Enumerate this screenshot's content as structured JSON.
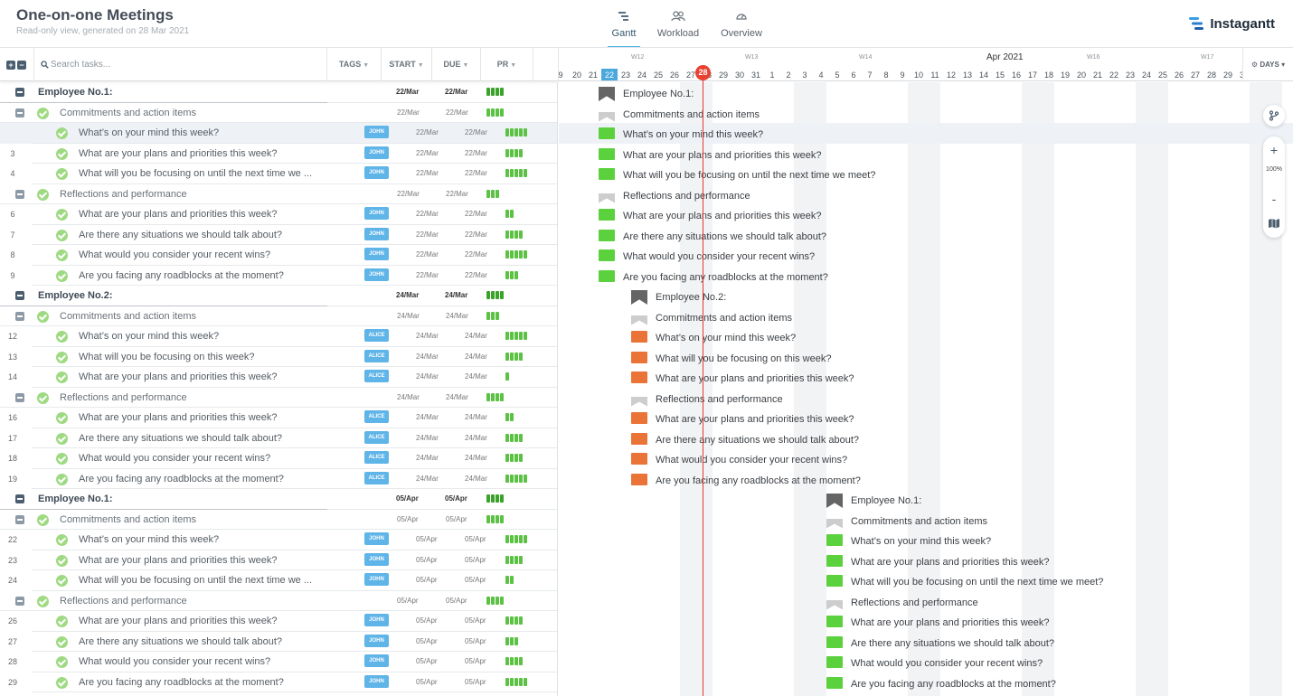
{
  "project": {
    "title": "One-on-one Meetings",
    "subtitle": "Read-only view, generated on 28 Mar 2021"
  },
  "tabs": [
    {
      "label": "Gantt",
      "icon": "gantt-icon",
      "active": true
    },
    {
      "label": "Workload",
      "icon": "users-icon",
      "active": false
    },
    {
      "label": "Overview",
      "icon": "dashboard-icon",
      "active": false
    }
  ],
  "brand": {
    "name": "Instagantt",
    "color": "#3b9ee8"
  },
  "search": {
    "placeholder": "Search tasks..."
  },
  "columns": {
    "tags": "TAGS",
    "start": "START",
    "due": "DUE",
    "pr": "PR"
  },
  "timeline": {
    "month": "Apr 2021",
    "weeks": [
      "W12",
      "W13",
      "W14",
      "W16",
      "W17"
    ],
    "days": [
      "9",
      "20",
      "21",
      "22",
      "23",
      "24",
      "25",
      "26",
      "27",
      "28",
      "29",
      "30",
      "31",
      "1",
      "2",
      "3",
      "4",
      "5",
      "6",
      "7",
      "8",
      "9",
      "10",
      "11",
      "12",
      "13",
      "14",
      "15",
      "16",
      "17",
      "18",
      "19",
      "20",
      "21",
      "22",
      "23",
      "24",
      "25",
      "26",
      "27",
      "28",
      "29",
      "30"
    ],
    "selected_day": "22",
    "today": "28",
    "scale_label": "DAYS"
  },
  "zoom": {
    "level": "100%",
    "plus": "+",
    "minus": "-"
  },
  "rows": [
    {
      "num": "",
      "type": "employee",
      "name": "Employee No.1:",
      "start": "22/Mar",
      "due": "22/Mar",
      "pr": 4
    },
    {
      "num": "",
      "type": "group",
      "name": "Commitments and action items",
      "start": "22/Mar",
      "due": "22/Mar",
      "pr": 4
    },
    {
      "num": "",
      "type": "task",
      "name": "What’s on your mind this week?",
      "tag": "JOHN",
      "start": "22/Mar",
      "due": "22/Mar",
      "pr": 5,
      "highlight": true
    },
    {
      "num": "3",
      "type": "task",
      "name": "What are your plans and priorities this week?",
      "tag": "JOHN",
      "start": "22/Mar",
      "due": "22/Mar",
      "pr": 4
    },
    {
      "num": "4",
      "type": "task",
      "name": "What will you be focusing on until the next time we ...",
      "tag": "JOHN",
      "start": "22/Mar",
      "due": "22/Mar",
      "pr": 5
    },
    {
      "num": "",
      "type": "group",
      "name": "Reflections and performance",
      "start": "22/Mar",
      "due": "22/Mar",
      "pr": 3
    },
    {
      "num": "6",
      "type": "task",
      "name": "What are your plans and priorities this week?",
      "tag": "JOHN",
      "start": "22/Mar",
      "due": "22/Mar",
      "pr": 2
    },
    {
      "num": "7",
      "type": "task",
      "name": "Are there any situations we should talk about?",
      "tag": "JOHN",
      "start": "22/Mar",
      "due": "22/Mar",
      "pr": 4
    },
    {
      "num": "8",
      "type": "task",
      "name": "What would you consider your recent wins?",
      "tag": "JOHN",
      "start": "22/Mar",
      "due": "22/Mar",
      "pr": 5
    },
    {
      "num": "9",
      "type": "task",
      "name": "Are you facing any roadblocks at the moment?",
      "tag": "JOHN",
      "start": "22/Mar",
      "due": "22/Mar",
      "pr": 3
    },
    {
      "num": "",
      "type": "employee",
      "name": "Employee No.2:",
      "start": "24/Mar",
      "due": "24/Mar",
      "pr": 4
    },
    {
      "num": "",
      "type": "group",
      "name": "Commitments and action items",
      "start": "24/Mar",
      "due": "24/Mar",
      "pr": 3
    },
    {
      "num": "12",
      "type": "task",
      "name": "What’s on your mind this week?",
      "tag": "ALICE",
      "start": "24/Mar",
      "due": "24/Mar",
      "pr": 5
    },
    {
      "num": "13",
      "type": "task",
      "name": "What will you be focusing on this week?",
      "tag": "ALICE",
      "start": "24/Mar",
      "due": "24/Mar",
      "pr": 4
    },
    {
      "num": "14",
      "type": "task",
      "name": "What are your plans and priorities this week?",
      "tag": "ALICE",
      "start": "24/Mar",
      "due": "24/Mar",
      "pr": 1
    },
    {
      "num": "",
      "type": "group",
      "name": "Reflections and performance",
      "start": "24/Mar",
      "due": "24/Mar",
      "pr": 4
    },
    {
      "num": "16",
      "type": "task",
      "name": "What are your plans and priorities this week?",
      "tag": "ALICE",
      "start": "24/Mar",
      "due": "24/Mar",
      "pr": 2
    },
    {
      "num": "17",
      "type": "task",
      "name": "Are there any situations we should talk about?",
      "tag": "ALICE",
      "start": "24/Mar",
      "due": "24/Mar",
      "pr": 4
    },
    {
      "num": "18",
      "type": "task",
      "name": "What would you consider your recent wins?",
      "tag": "ALICE",
      "start": "24/Mar",
      "due": "24/Mar",
      "pr": 4
    },
    {
      "num": "19",
      "type": "task",
      "name": "Are you facing any roadblocks at the moment?",
      "tag": "ALICE",
      "start": "24/Mar",
      "due": "24/Mar",
      "pr": 5
    },
    {
      "num": "",
      "type": "employee",
      "name": "Employee No.1:",
      "start": "05/Apr",
      "due": "05/Apr",
      "pr": 4
    },
    {
      "num": "",
      "type": "group",
      "name": "Commitments and action items",
      "start": "05/Apr",
      "due": "05/Apr",
      "pr": 4
    },
    {
      "num": "22",
      "type": "task",
      "name": "What’s on your mind this week?",
      "tag": "JOHN",
      "start": "05/Apr",
      "due": "05/Apr",
      "pr": 5
    },
    {
      "num": "23",
      "type": "task",
      "name": "What are your plans and priorities this week?",
      "tag": "JOHN",
      "start": "05/Apr",
      "due": "05/Apr",
      "pr": 4
    },
    {
      "num": "24",
      "type": "task",
      "name": "What will you be focusing on until the next time we ...",
      "tag": "JOHN",
      "start": "05/Apr",
      "due": "05/Apr",
      "pr": 2
    },
    {
      "num": "",
      "type": "group",
      "name": "Reflections and performance",
      "start": "05/Apr",
      "due": "05/Apr",
      "pr": 4
    },
    {
      "num": "26",
      "type": "task",
      "name": "What are your plans and priorities this week?",
      "tag": "JOHN",
      "start": "05/Apr",
      "due": "05/Apr",
      "pr": 4
    },
    {
      "num": "27",
      "type": "task",
      "name": "Are there any situations we should talk about?",
      "tag": "JOHN",
      "start": "05/Apr",
      "due": "05/Apr",
      "pr": 3
    },
    {
      "num": "28",
      "type": "task",
      "name": "What would you consider your recent wins?",
      "tag": "JOHN",
      "start": "05/Apr",
      "due": "05/Apr",
      "pr": 4
    },
    {
      "num": "29",
      "type": "task",
      "name": "Are you facing any roadblocks at the moment?",
      "tag": "JOHN",
      "start": "05/Apr",
      "due": "05/Apr",
      "pr": 5
    }
  ],
  "gantt_items": [
    {
      "label": "Employee No.1:",
      "kind": "employee",
      "color": "#656565"
    },
    {
      "label": "Commitments and action items",
      "kind": "group",
      "color": "#cdcdcd"
    },
    {
      "label": "What’s on your mind this week?",
      "kind": "task",
      "color": "#5bd13e"
    },
    {
      "label": "What are your plans and priorities this week?",
      "kind": "task",
      "color": "#5bd13e"
    },
    {
      "label": "What will you be focusing on until the next time we meet?",
      "kind": "task",
      "color": "#5bd13e"
    },
    {
      "label": "Reflections and performance",
      "kind": "group",
      "color": "#cdcdcd"
    },
    {
      "label": "What are your plans and priorities this week?",
      "kind": "task",
      "color": "#5bd13e"
    },
    {
      "label": "Are there any situations we should talk about?",
      "kind": "task",
      "color": "#5bd13e"
    },
    {
      "label": "What would you consider your recent wins?",
      "kind": "task",
      "color": "#5bd13e"
    },
    {
      "label": "Are you facing any roadblocks at the moment?",
      "kind": "task",
      "color": "#5bd13e"
    },
    {
      "label": "Employee No.2:",
      "kind": "employee",
      "color": "#656565"
    },
    {
      "label": "Commitments and action items",
      "kind": "group",
      "color": "#cdcdcd"
    },
    {
      "label": "What’s on your mind this week?",
      "kind": "task",
      "color": "#ea7337"
    },
    {
      "label": "What will you be focusing on this week?",
      "kind": "task",
      "color": "#ea7337"
    },
    {
      "label": "What are your plans and priorities this week?",
      "kind": "task",
      "color": "#ea7337"
    },
    {
      "label": "Reflections and performance",
      "kind": "group",
      "color": "#cdcdcd"
    },
    {
      "label": "What are your plans and priorities this week?",
      "kind": "task",
      "color": "#ea7337"
    },
    {
      "label": "Are there any situations we should talk about?",
      "kind": "task",
      "color": "#ea7337"
    },
    {
      "label": "What would you consider your recent wins?",
      "kind": "task",
      "color": "#ea7337"
    },
    {
      "label": "Are you facing any roadblocks at the moment?",
      "kind": "task",
      "color": "#ea7337"
    },
    {
      "label": "Employee No.1:",
      "kind": "employee",
      "color": "#656565"
    },
    {
      "label": "Commitments and action items",
      "kind": "group",
      "color": "#cdcdcd"
    },
    {
      "label": "What’s on your mind this week?",
      "kind": "task",
      "color": "#5bd13e"
    },
    {
      "label": "What are your plans and priorities this week?",
      "kind": "task",
      "color": "#5bd13e"
    },
    {
      "label": "What will you be focusing on until the next time we meet?",
      "kind": "task",
      "color": "#5bd13e"
    },
    {
      "label": "Reflections and performance",
      "kind": "group",
      "color": "#cdcdcd"
    },
    {
      "label": "What are your plans and priorities this week?",
      "kind": "task",
      "color": "#5bd13e"
    },
    {
      "label": "Are there any situations we should talk about?",
      "kind": "task",
      "color": "#5bd13e"
    },
    {
      "label": "What would you consider your recent wins?",
      "kind": "task",
      "color": "#5bd13e"
    },
    {
      "label": "Are you facing any roadblocks at the moment?",
      "kind": "task",
      "color": "#5bd13e"
    }
  ]
}
